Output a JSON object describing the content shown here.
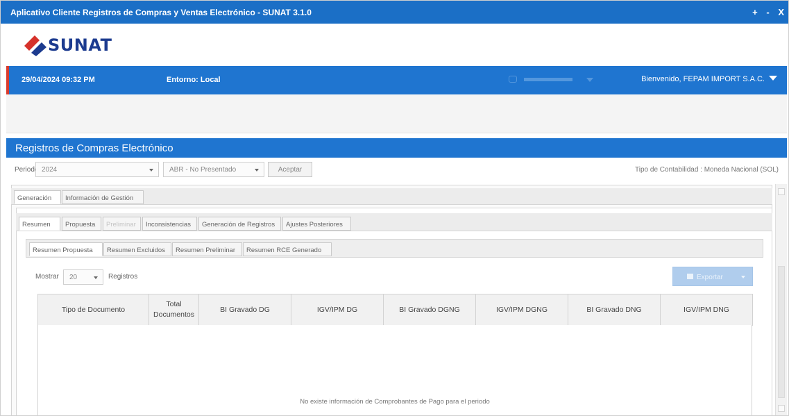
{
  "window": {
    "title": "Aplicativo Cliente Registros de Compras y Ventas Electrónico - SUNAT 3.1.0",
    "controls": [
      "+",
      "-",
      "X"
    ]
  },
  "logo": {
    "text": "SUNAT",
    "icon": "sunat-diamond-logo"
  },
  "header": {
    "datetime": "29/04/2024 09:32 PM",
    "environment": "Entorno: Local",
    "user": "Bienvenido, FEPAM IMPORT S.A.C."
  },
  "panel": {
    "title": "Registros de Compras Electrónico"
  },
  "filters": {
    "periodo_label": "Periodo:",
    "year": "2024",
    "month": "ABR - No Presentado",
    "accept": "Aceptar",
    "contabilidad": "Tipo de Contabilidad : Moneda Nacional (SOL)"
  },
  "tabs_level1": [
    {
      "label": "Generación",
      "active": true
    },
    {
      "label": "Información de Gestión",
      "active": false
    }
  ],
  "tabs_level2": [
    {
      "label": "Resumen",
      "active": true,
      "disabled": false
    },
    {
      "label": "Propuesta",
      "active": false,
      "disabled": false
    },
    {
      "label": "Preliminar",
      "active": false,
      "disabled": true
    },
    {
      "label": "Inconsistencias",
      "active": false,
      "disabled": false
    },
    {
      "label": "Generación de Registros",
      "active": false,
      "disabled": false
    },
    {
      "label": "Ajustes Posteriores",
      "active": false,
      "disabled": false
    }
  ],
  "tabs_level3": [
    {
      "label": "Resumen Propuesta",
      "active": true
    },
    {
      "label": "Resumen Excluidos",
      "active": false
    },
    {
      "label": "Resumen Preliminar",
      "active": false
    },
    {
      "label": "Resumen RCE Generado",
      "active": false
    }
  ],
  "list": {
    "show_label": "Mostrar",
    "page_size": "20",
    "records_label": "Registros",
    "export_label": "Exportar"
  },
  "table": {
    "columns": [
      "Tipo de Documento",
      "Total Documentos",
      "BI Gravado DG",
      "IGV/IPM DG",
      "BI Gravado DGNG",
      "IGV/IPM DGNG",
      "BI Gravado DNG",
      "IGV/IPM DNG"
    ],
    "empty_message": "No existe información de Comprobantes de Pago para el periodo"
  },
  "colors": {
    "primary": "#1f75d0",
    "titlebar": "#1b6fc6",
    "logo_text": "#1c3b8f",
    "logo_red": "#d6322b"
  }
}
